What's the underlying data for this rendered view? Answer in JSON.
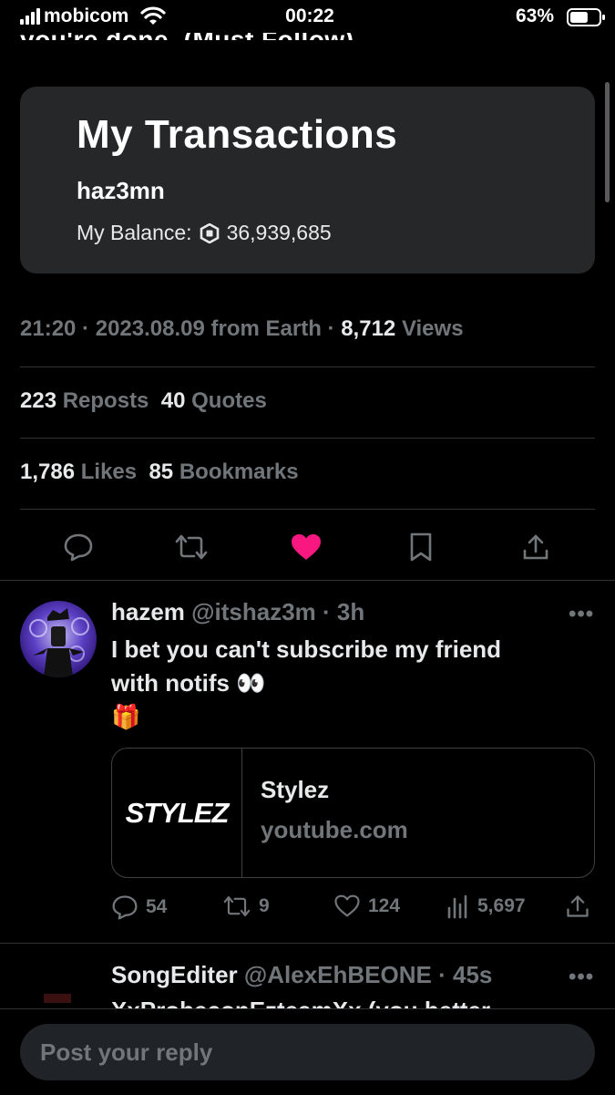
{
  "status_bar": {
    "carrier": "mobicom",
    "time": "00:22",
    "battery": "63%",
    "battery_level": 0.63
  },
  "post": {
    "cut_text": "you're done. (Must Follow)",
    "card": {
      "title": "My Transactions",
      "username": "haz3mn",
      "balance_label": "My Balance:",
      "balance_value": "36,939,685"
    },
    "meta": {
      "time": "21:20",
      "date": "2023.08.09",
      "source": "from Earth",
      "views_count": "8,712",
      "views_label": "Views"
    },
    "stats": {
      "reposts_count": "223",
      "reposts_label": "Reposts",
      "quotes_count": "40",
      "quotes_label": "Quotes",
      "likes_count": "1,786",
      "likes_label": "Likes",
      "bookmarks_count": "85",
      "bookmarks_label": "Bookmarks"
    },
    "actions": [
      "reply-icon",
      "repost-icon",
      "like-icon-filled",
      "bookmark-icon",
      "share-icon"
    ],
    "like_color": "#f91880"
  },
  "replies": [
    {
      "display_name": "hazem",
      "handle": "@itshaz3m",
      "time": "3h",
      "text_line1": "I bet you can't subscribe my friend",
      "text_line2": "with notifs 👀",
      "text_line3": "🎁",
      "link_card": {
        "logo_text": "STYLEZ",
        "title": "Stylez",
        "domain": "youtube.com"
      },
      "actions": {
        "replies": "54",
        "reposts": "9",
        "likes": "124",
        "views": "5,697"
      }
    },
    {
      "display_name": "SongEditer",
      "handle": "@AlexEhBEONE",
      "time": "45s",
      "text_cut": "XxProbeconEzteamXx (you better"
    }
  ],
  "composer": {
    "placeholder": "Post your reply"
  }
}
